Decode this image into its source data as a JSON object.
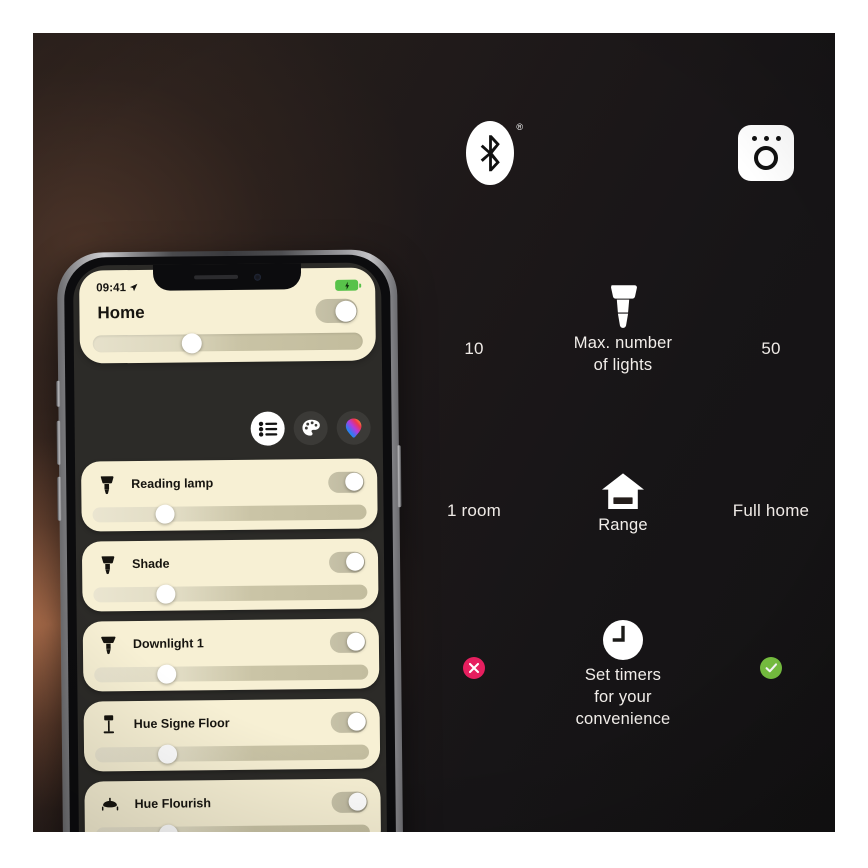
{
  "scene": {
    "background_dark": "#141315",
    "glow_color": "#c47c54"
  },
  "phone": {
    "status_bar": {
      "time": "09:41",
      "location_icon": "location-arrow-icon",
      "battery_icon": "battery-charging-icon",
      "battery_color": "#58c24a"
    },
    "home_card": {
      "title": "Home",
      "master_toggle_state": "on",
      "brightness_percent": 33
    },
    "segment_buttons": [
      {
        "name": "list-view-button",
        "icon": "list-icon",
        "active": true
      },
      {
        "name": "scenes-button",
        "icon": "palette-icon",
        "active": false
      },
      {
        "name": "color-button",
        "icon": "color-bulb-icon",
        "active": false
      }
    ],
    "lights": [
      {
        "name": "Reading lamp",
        "icon": "spot-bulb-icon",
        "toggle_state": "on",
        "brightness_percent": 23
      },
      {
        "name": "Shade",
        "icon": "spot-bulb-icon",
        "toggle_state": "on",
        "brightness_percent": 23
      },
      {
        "name": "Downlight 1",
        "icon": "downlight-icon",
        "toggle_state": "on",
        "brightness_percent": 23
      },
      {
        "name": "Hue Signe Floor",
        "icon": "floor-lamp-icon",
        "toggle_state": "on",
        "brightness_percent": 23
      },
      {
        "name": "Hue Flourish",
        "icon": "ceiling-lamp-icon",
        "toggle_state": "on",
        "brightness_percent": 23
      }
    ]
  },
  "comparison": {
    "header": {
      "left_icon": "bluetooth-icon",
      "left_icon_mark": "®",
      "right_icon": "hue-bridge-icon"
    },
    "rows": [
      {
        "id": "max-lights",
        "left_value": "10",
        "icon": "light-bulb-icon",
        "label": "Max. number\nof lights",
        "label_line1": "Max. number",
        "label_line2": "of lights",
        "right_value": "50"
      },
      {
        "id": "range",
        "left_value": "1 room",
        "icon": "house-icon",
        "label": "Range",
        "label_line1": "Range",
        "label_line2": "",
        "right_value": "Full home"
      },
      {
        "id": "timers",
        "left_value": "",
        "left_badge": "cross-badge",
        "left_badge_color": "#e61f5f",
        "icon": "clock-icon",
        "label_line1": "Set timers",
        "label_line2": "for your",
        "label_line3": "convenience",
        "right_value": "",
        "right_badge": "check-badge",
        "right_badge_color": "#79c341"
      }
    ]
  }
}
